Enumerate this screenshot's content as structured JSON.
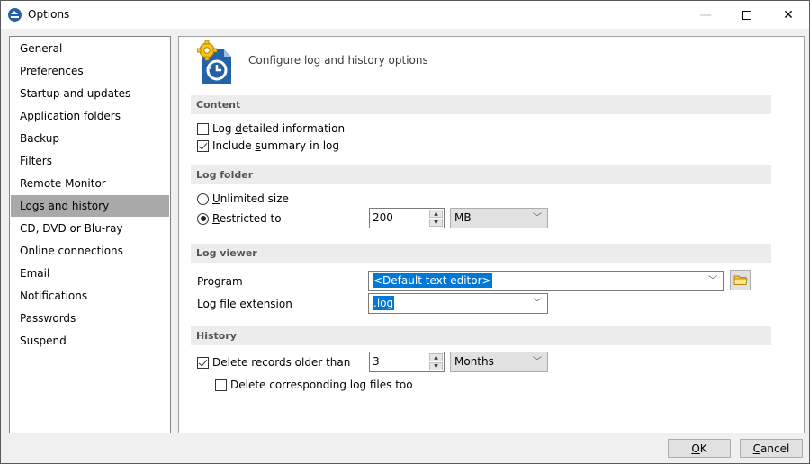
{
  "window": {
    "title": "Options",
    "controls": {
      "minimize": "—",
      "maximize": "",
      "close": "✕"
    }
  },
  "sidebar": {
    "items": [
      {
        "label": "General",
        "selected": false
      },
      {
        "label": "Preferences",
        "selected": false
      },
      {
        "label": "Startup and updates",
        "selected": false
      },
      {
        "label": "Application folders",
        "selected": false
      },
      {
        "label": "Backup",
        "selected": false
      },
      {
        "label": "Filters",
        "selected": false
      },
      {
        "label": "Remote Monitor",
        "selected": false
      },
      {
        "label": "Logs and history",
        "selected": true
      },
      {
        "label": "CD, DVD or Blu-ray",
        "selected": false
      },
      {
        "label": "Online connections",
        "selected": false
      },
      {
        "label": "Email",
        "selected": false
      },
      {
        "label": "Notifications",
        "selected": false
      },
      {
        "label": "Passwords",
        "selected": false
      },
      {
        "label": "Suspend",
        "selected": false
      }
    ]
  },
  "header": {
    "icon": "log-history-settings-icon",
    "text": "Configure log and history options"
  },
  "content_section": {
    "title": "Content",
    "log_detailed": {
      "pre": "Log ",
      "accel": "d",
      "post": "etailed information",
      "checked": false
    },
    "include_summary": {
      "pre": "Include ",
      "accel": "s",
      "post": "ummary in log",
      "checked": true
    }
  },
  "log_folder": {
    "title": "Log folder",
    "unlimited": {
      "accel": "U",
      "post": "nlimited size",
      "checked": false
    },
    "restricted": {
      "accel": "R",
      "post": "estricted to",
      "checked": true
    },
    "size_value": "200",
    "size_unit": "MB"
  },
  "log_viewer": {
    "title": "Log viewer",
    "program_label": "Program",
    "program_value": "<Default text editor>",
    "extension_label": "Log file extension",
    "extension_value": ".log"
  },
  "history": {
    "title": "History",
    "delete_records": {
      "label": "Delete records older than",
      "checked": true
    },
    "age_value": "3",
    "age_unit": "Months",
    "delete_log_files": {
      "label": "Delete corresponding log files too",
      "checked": false
    }
  },
  "buttons": {
    "ok": {
      "accel": "O",
      "post": "K"
    },
    "cancel": {
      "accel": "C",
      "post": "ancel"
    }
  },
  "colors": {
    "selection": "#0078d7",
    "sidebar_selected": "#a9a9a9",
    "icon_blue": "#2461a8",
    "gear_yellow": "#f5c518"
  }
}
